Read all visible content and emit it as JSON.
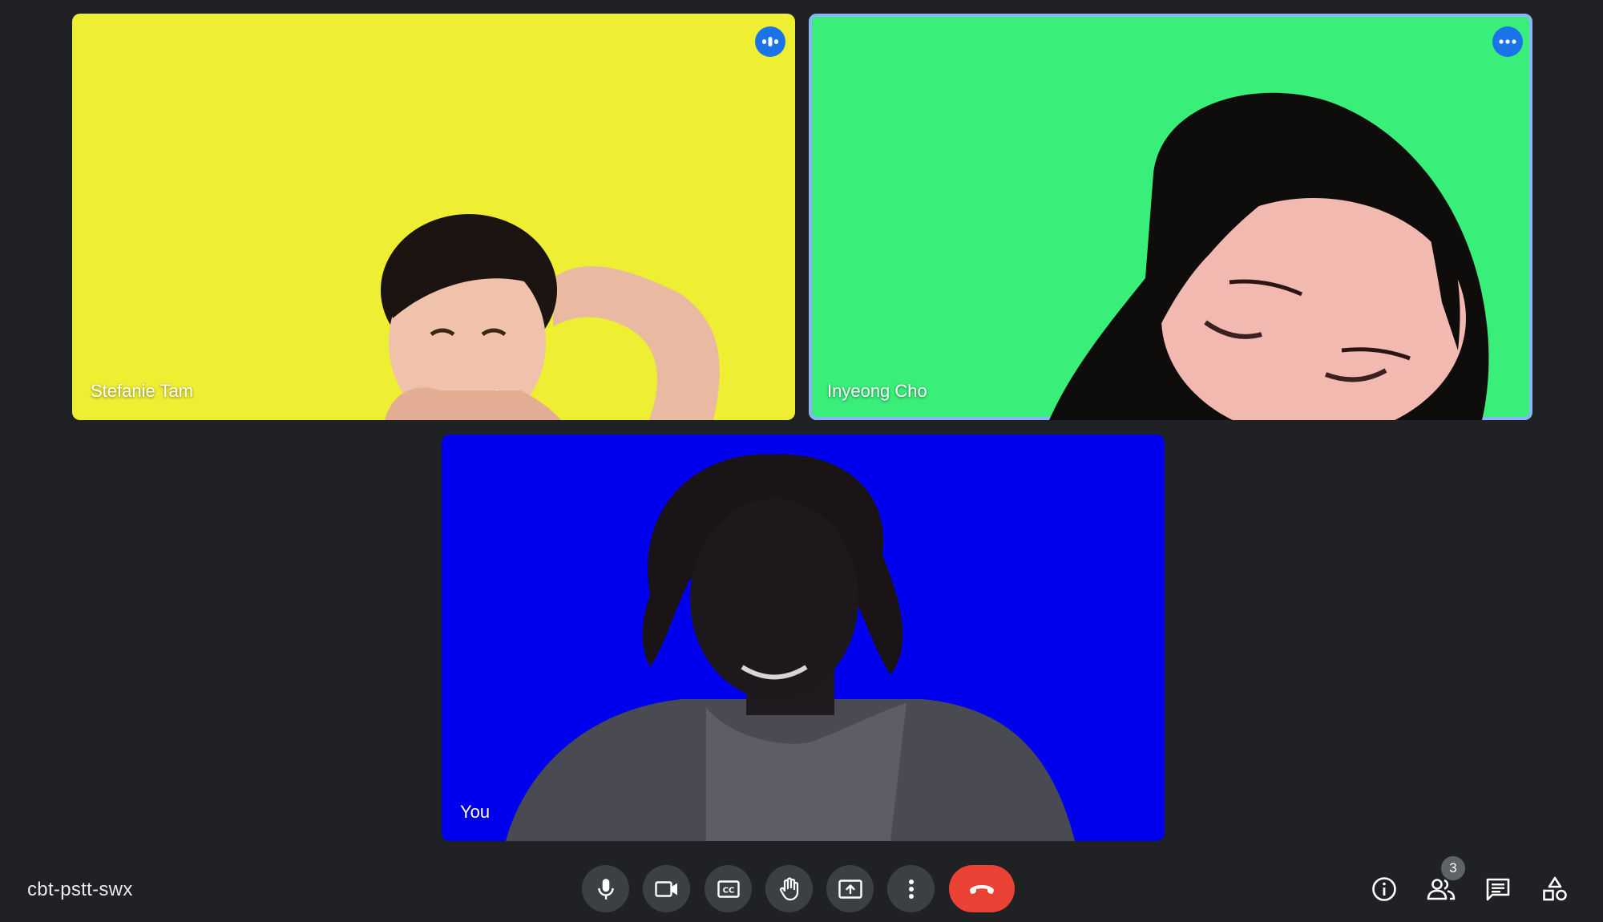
{
  "meeting": {
    "code": "cbt-pstt-swx"
  },
  "participants": [
    {
      "name": "Stefanie Tam",
      "background": "#eeee33",
      "indicator": "audio-level-icon"
    },
    {
      "name": "Inyeong Cho",
      "background": "#3aee7a",
      "indicator": "more-options-icon",
      "speaking": true
    },
    {
      "name": "You",
      "background": "#0000ee"
    }
  ],
  "controls": {
    "mic": "microphone-icon",
    "camera": "camera-icon",
    "captions": "closed-captions-icon",
    "raise_hand": "raise-hand-icon",
    "present": "present-screen-icon",
    "more": "more-vert-icon",
    "leave": "end-call-icon"
  },
  "side_panel": {
    "people_count": "3",
    "icons": [
      "info-icon",
      "people-icon",
      "chat-icon",
      "activities-icon"
    ]
  },
  "colors": {
    "background": "#202124",
    "control_bg": "#3c4043",
    "end_call": "#ea4335",
    "accent": "#1a73e8",
    "speaking_border": "#8ab4f8"
  }
}
